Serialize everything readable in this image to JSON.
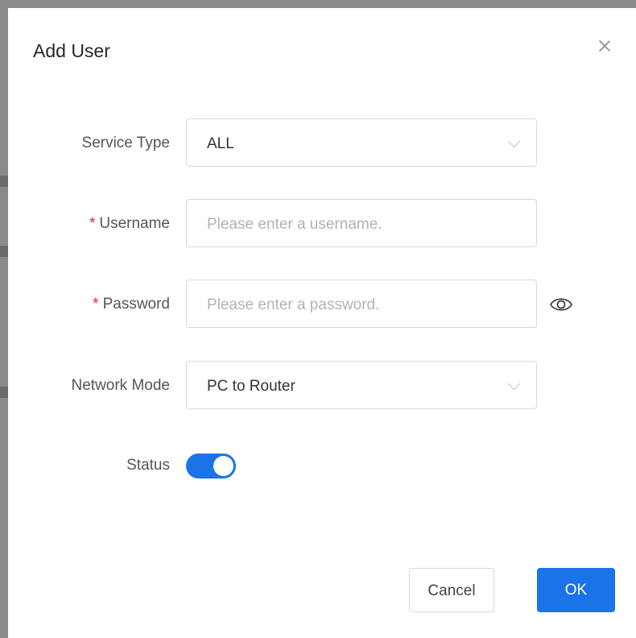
{
  "dialog": {
    "title": "Add User"
  },
  "form": {
    "service_type": {
      "label": "Service Type",
      "value": "ALL",
      "icon": "chevron-down-icon"
    },
    "username": {
      "required_mark": "*",
      "label": "Username",
      "value": "",
      "placeholder": "Please enter a username."
    },
    "password": {
      "required_mark": "*",
      "label": "Password",
      "value": "",
      "placeholder": "Please enter a password.",
      "icon": "eye-icon"
    },
    "network_mode": {
      "label": "Network Mode",
      "value": "PC to Router",
      "icon": "chevron-down-icon"
    },
    "status": {
      "label": "Status",
      "enabled": true
    }
  },
  "footer": {
    "cancel_label": "Cancel",
    "ok_label": "OK"
  },
  "colors": {
    "primary": "#1a73e8",
    "required": "#f5222d",
    "border": "#d9d9d9",
    "placeholder": "#b3b3b3"
  }
}
